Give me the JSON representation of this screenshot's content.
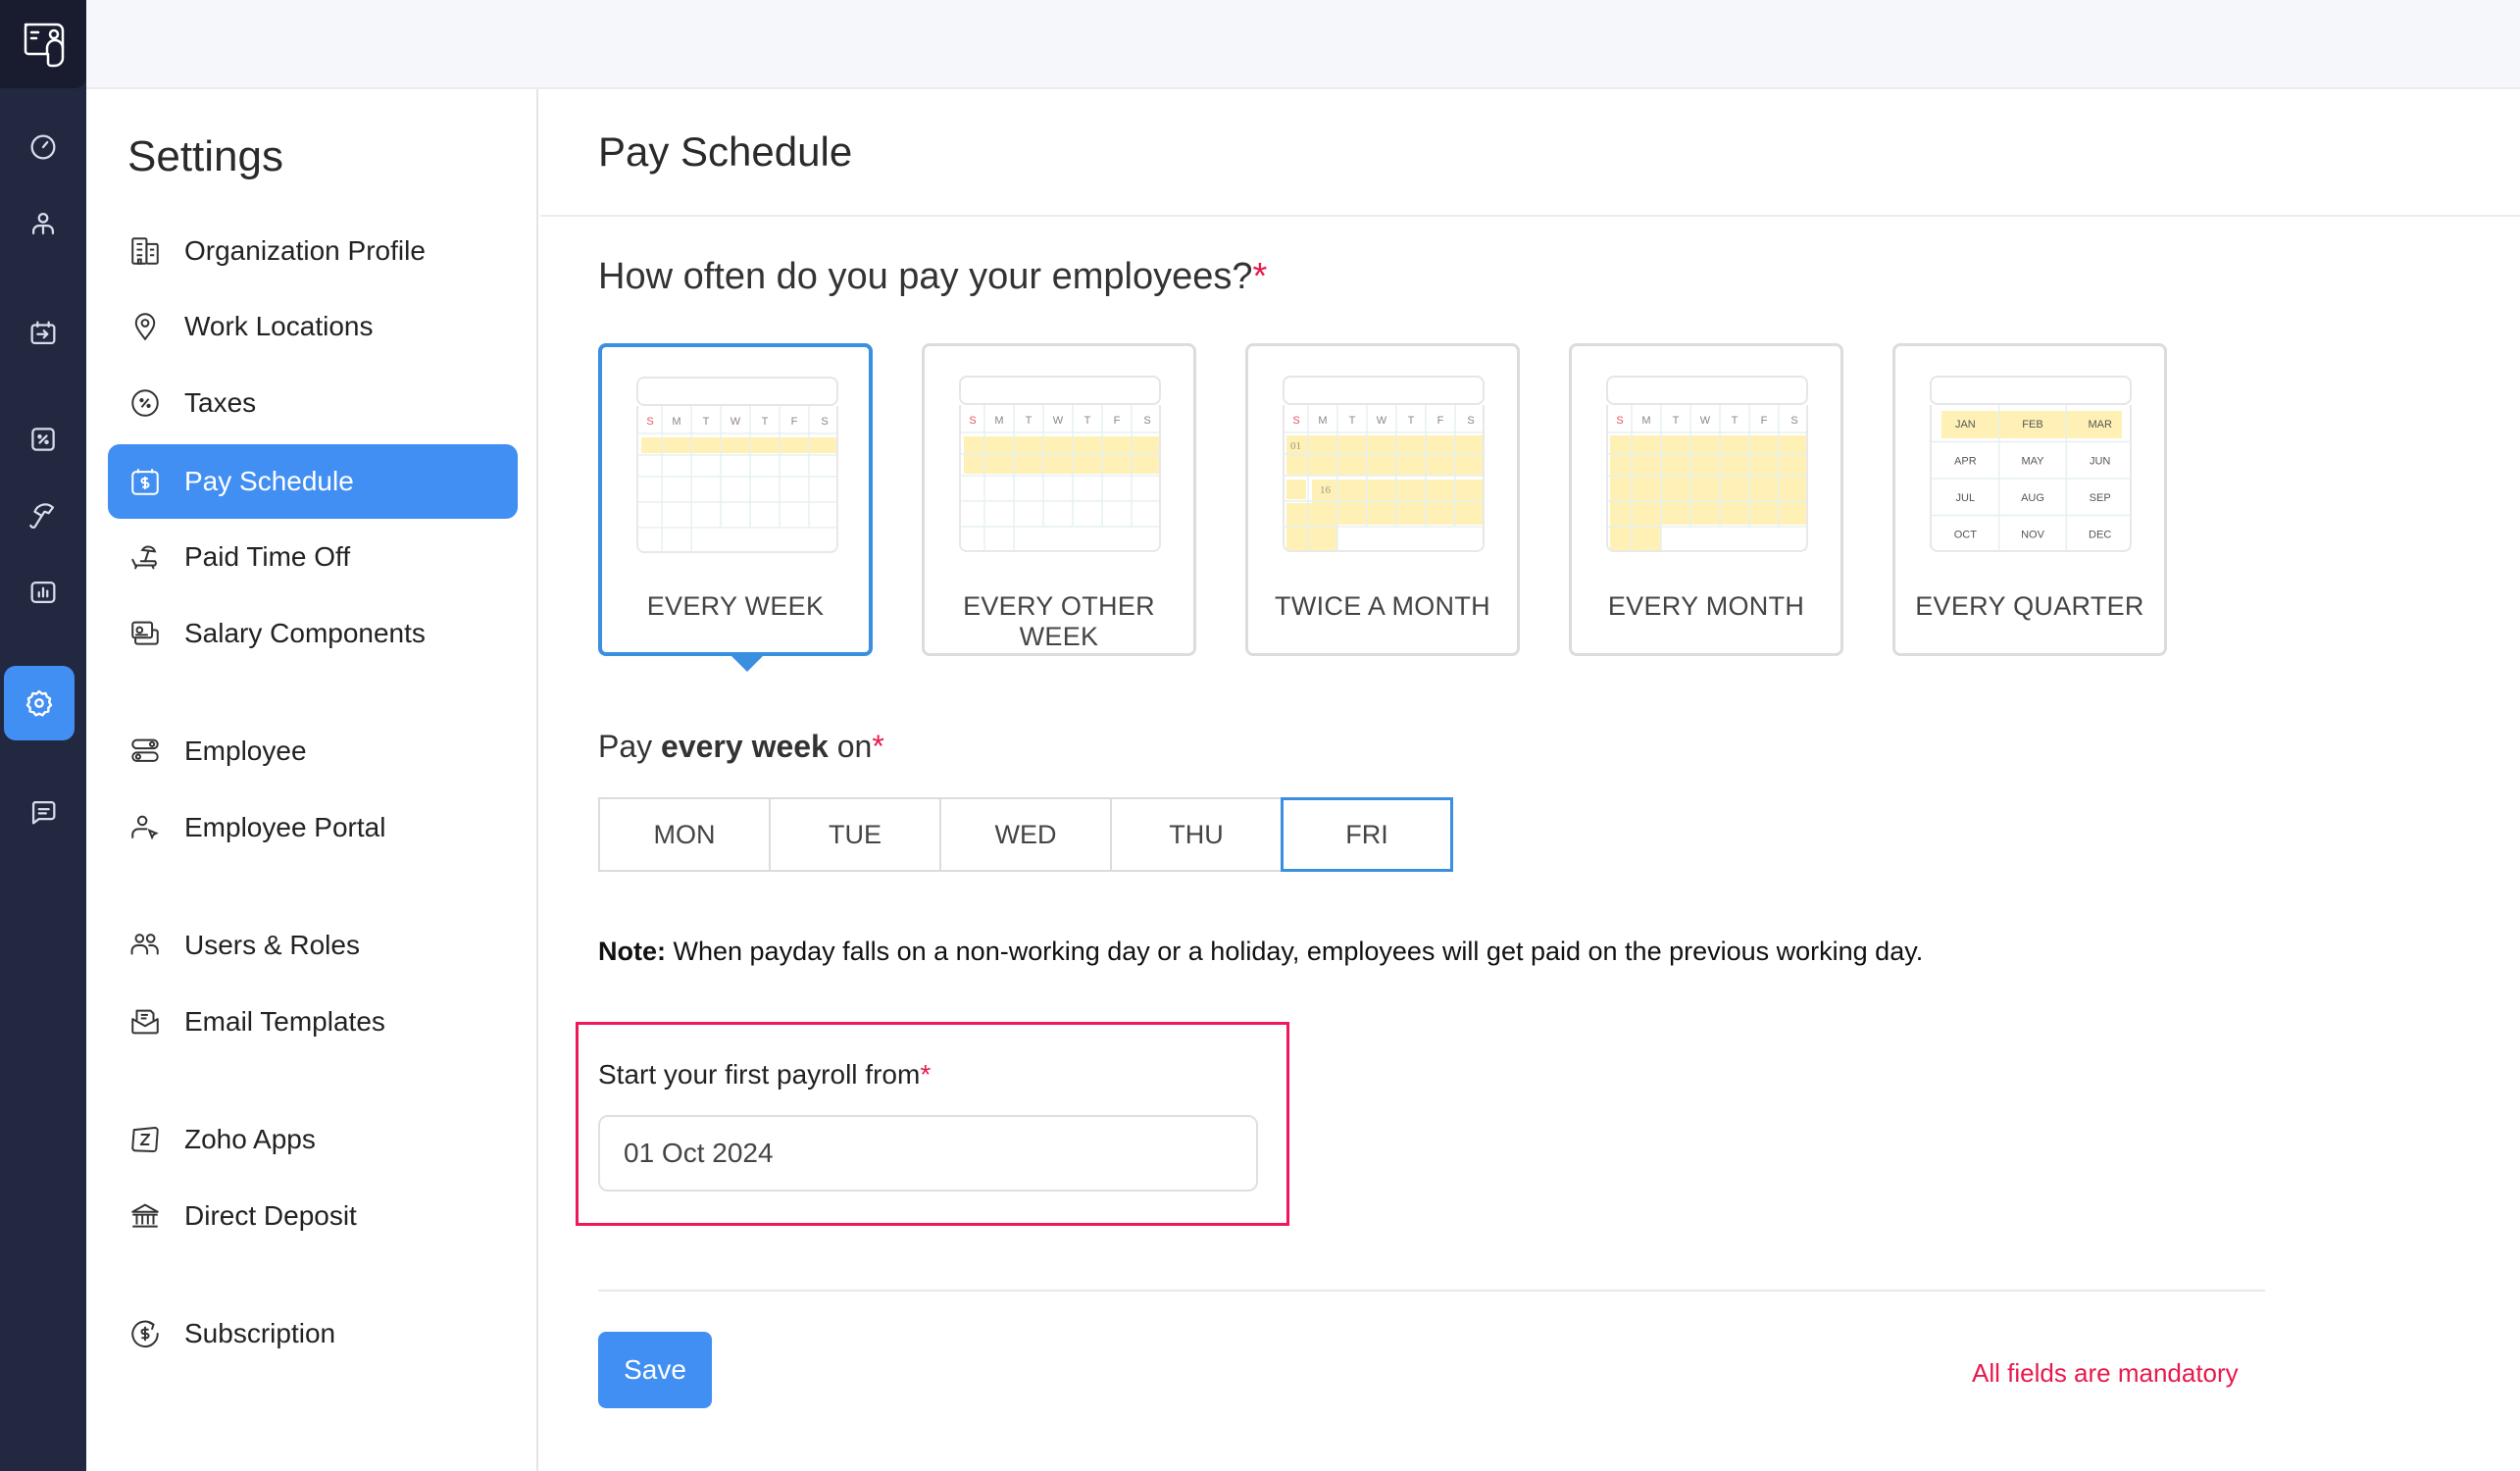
{
  "rail": {
    "items": [
      {
        "icon": "dashboard-icon"
      },
      {
        "icon": "employees-icon"
      },
      {
        "icon": "pay-runs-icon"
      },
      {
        "icon": "taxes-icon"
      },
      {
        "icon": "benefits-icon"
      },
      {
        "icon": "reports-icon"
      },
      {
        "icon": "settings-icon",
        "active": true
      },
      {
        "icon": "feedback-icon"
      }
    ]
  },
  "settings": {
    "title": "Settings",
    "items": [
      {
        "label": "Organization Profile",
        "icon": "building-icon"
      },
      {
        "label": "Work Locations",
        "icon": "location-pin-icon"
      },
      {
        "label": "Taxes",
        "icon": "percent-icon"
      },
      {
        "label": "Pay Schedule",
        "icon": "dollar-calendar-icon",
        "active": true
      },
      {
        "label": "Paid Time Off",
        "icon": "beach-chair-icon"
      },
      {
        "label": "Salary Components",
        "icon": "money-icon"
      },
      {
        "label": "Employee",
        "icon": "toggles-icon"
      },
      {
        "label": "Employee Portal",
        "icon": "user-cursor-icon"
      },
      {
        "label": "Users & Roles",
        "icon": "users-icon"
      },
      {
        "label": "Email Templates",
        "icon": "email-icon"
      },
      {
        "label": "Zoho Apps",
        "icon": "zoho-icon"
      },
      {
        "label": "Direct Deposit",
        "icon": "bank-icon"
      },
      {
        "label": "Subscription",
        "icon": "subscription-icon"
      }
    ]
  },
  "main": {
    "title": "Pay Schedule",
    "question": "How often do you pay your employees?",
    "required_mark": "*",
    "weekday_letters": [
      "S",
      "M",
      "T",
      "W",
      "T",
      "F",
      "S"
    ],
    "frequencies": [
      {
        "label": "EVERY WEEK",
        "selected": true
      },
      {
        "label": "EVERY OTHER WEEK",
        "selected": false
      },
      {
        "label": "TWICE A MONTH",
        "selected": false,
        "day_markers": [
          "01",
          "16"
        ]
      },
      {
        "label": "EVERY MONTH",
        "selected": false
      },
      {
        "label": "EVERY QUARTER",
        "selected": false,
        "months": [
          "JAN",
          "FEB",
          "MAR",
          "APR",
          "MAY",
          "JUN",
          "JUL",
          "AUG",
          "SEP",
          "OCT",
          "NOV",
          "DEC"
        ]
      }
    ],
    "pay_on": {
      "prefix": "Pay ",
      "emphasis": "every week",
      "suffix": " on",
      "days": [
        {
          "label": "MON",
          "selected": false
        },
        {
          "label": "TUE",
          "selected": false
        },
        {
          "label": "WED",
          "selected": false
        },
        {
          "label": "THU",
          "selected": false
        },
        {
          "label": "FRI",
          "selected": true
        }
      ]
    },
    "note": {
      "bold": "Note:",
      "text": " When payday falls on a non-working day or a holiday, employees will get paid on the previous working day."
    },
    "start": {
      "label": "Start your first payroll from",
      "value": "01 Oct 2024"
    },
    "save_label": "Save",
    "mandatory_text": "All fields are mandatory"
  },
  "colors": {
    "accent": "#428ff4",
    "selected_border": "#3b8fe0",
    "required": "#e8194b",
    "highlight_fill": "#fff1b5",
    "rail_bg": "#222840"
  }
}
